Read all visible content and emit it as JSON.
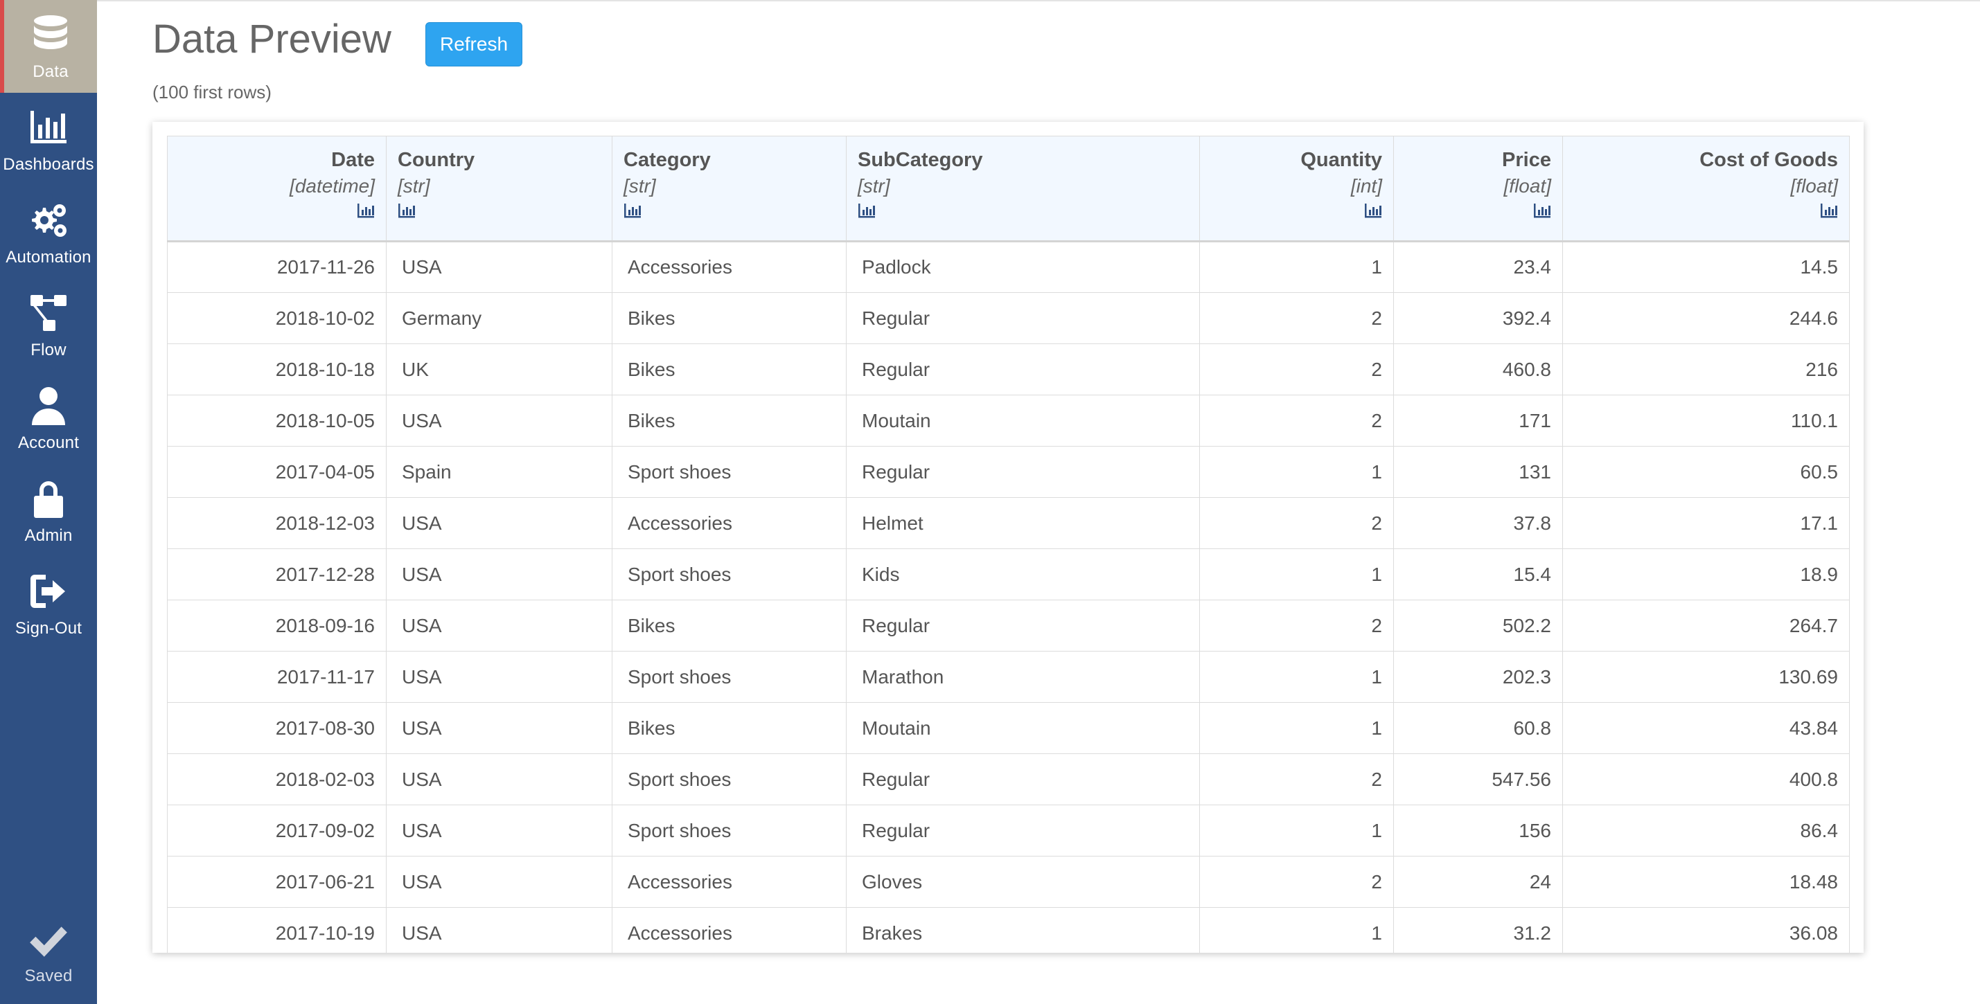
{
  "sidebar": {
    "items": [
      {
        "label": "Data",
        "icon": "database-icon"
      },
      {
        "label": "Dashboards",
        "icon": "bar-chart-icon"
      },
      {
        "label": "Automation",
        "icon": "gears-icon"
      },
      {
        "label": "Flow",
        "icon": "flow-icon"
      },
      {
        "label": "Account",
        "icon": "user-icon"
      },
      {
        "label": "Admin",
        "icon": "lock-icon"
      },
      {
        "label": "Sign-Out",
        "icon": "sign-out-icon"
      }
    ],
    "saved_label": "Saved"
  },
  "header": {
    "title": "Data Preview",
    "refresh_label": "Refresh",
    "subtitle": "(100 first rows)"
  },
  "table": {
    "columns": [
      {
        "name": "Date",
        "type": "[datetime]"
      },
      {
        "name": "Country",
        "type": "[str]"
      },
      {
        "name": "Category",
        "type": "[str]"
      },
      {
        "name": "SubCategory",
        "type": "[str]"
      },
      {
        "name": "Quantity",
        "type": "[int]"
      },
      {
        "name": "Price",
        "type": "[float]"
      },
      {
        "name": "Cost of Goods",
        "type": "[float]"
      }
    ],
    "rows": [
      [
        "2017-11-26",
        "USA",
        "Accessories",
        "Padlock",
        "1",
        "23.4",
        "14.5"
      ],
      [
        "2018-10-02",
        "Germany",
        "Bikes",
        "Regular",
        "2",
        "392.4",
        "244.6"
      ],
      [
        "2018-10-18",
        "UK",
        "Bikes",
        "Regular",
        "2",
        "460.8",
        "216"
      ],
      [
        "2018-10-05",
        "USA",
        "Bikes",
        "Moutain",
        "2",
        "171",
        "110.1"
      ],
      [
        "2017-04-05",
        "Spain",
        "Sport shoes",
        "Regular",
        "1",
        "131",
        "60.5"
      ],
      [
        "2018-12-03",
        "USA",
        "Accessories",
        "Helmet",
        "2",
        "37.8",
        "17.1"
      ],
      [
        "2017-12-28",
        "USA",
        "Sport shoes",
        "Kids",
        "1",
        "15.4",
        "18.9"
      ],
      [
        "2018-09-16",
        "USA",
        "Bikes",
        "Regular",
        "2",
        "502.2",
        "264.7"
      ],
      [
        "2017-11-17",
        "USA",
        "Sport shoes",
        "Marathon",
        "1",
        "202.3",
        "130.69"
      ],
      [
        "2017-08-30",
        "USA",
        "Bikes",
        "Moutain",
        "1",
        "60.8",
        "43.84"
      ],
      [
        "2018-02-03",
        "USA",
        "Sport shoes",
        "Regular",
        "2",
        "547.56",
        "400.8"
      ],
      [
        "2017-09-02",
        "USA",
        "Sport shoes",
        "Regular",
        "1",
        "156",
        "86.4"
      ],
      [
        "2017-06-21",
        "USA",
        "Accessories",
        "Gloves",
        "2",
        "24",
        "18.48"
      ],
      [
        "2017-10-19",
        "USA",
        "Accessories",
        "Brakes",
        "1",
        "31.2",
        "36.08"
      ]
    ]
  },
  "colors": {
    "sidebar_bg": "#2f5083",
    "active_bg": "#b8b2a3",
    "active_accent": "#d94b4b",
    "button_bg": "#2ea4f0",
    "header_bg": "#f2f8ff",
    "chart_icon": "#2f5083"
  }
}
